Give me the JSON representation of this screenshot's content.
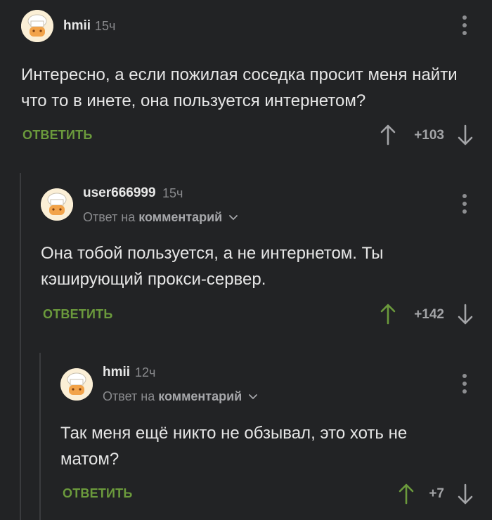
{
  "comments": [
    {
      "username": "hmii",
      "time": "15ч",
      "text": "Интересно, а если пожилая соседка просит меня найти что то в инете, она пользуется интернетом?",
      "reply_label": "ОТВЕТИТЬ",
      "rating": "+103",
      "upvoted": false
    },
    {
      "username": "user666999",
      "time": "15ч",
      "reply_prefix": "Ответ на",
      "reply_target": "комментарий",
      "text": "Она тобой пользуется, а не интернетом. Ты кэширующий прокси-сервер.",
      "reply_label": "ОТВЕТИТЬ",
      "rating": "+142",
      "upvoted": true
    },
    {
      "username": "hmii",
      "time": "12ч",
      "reply_prefix": "Ответ на",
      "reply_target": "комментарий",
      "text": "Так меня ещё никто не обзывал, это хоть не матом?",
      "reply_label": "ОТВЕТИТЬ",
      "rating": "+7",
      "upvoted": true
    }
  ],
  "colors": {
    "background": "#222325",
    "accent_green": "#6b9a3c",
    "muted_text": "#8a8b8e"
  },
  "icons": {
    "avatar": "chef-avatar-icon",
    "menu": "more-vertical-icon",
    "upvote": "arrow-up-icon",
    "downvote": "arrow-down-icon",
    "reply_chevron": "chevron-down-icon"
  }
}
